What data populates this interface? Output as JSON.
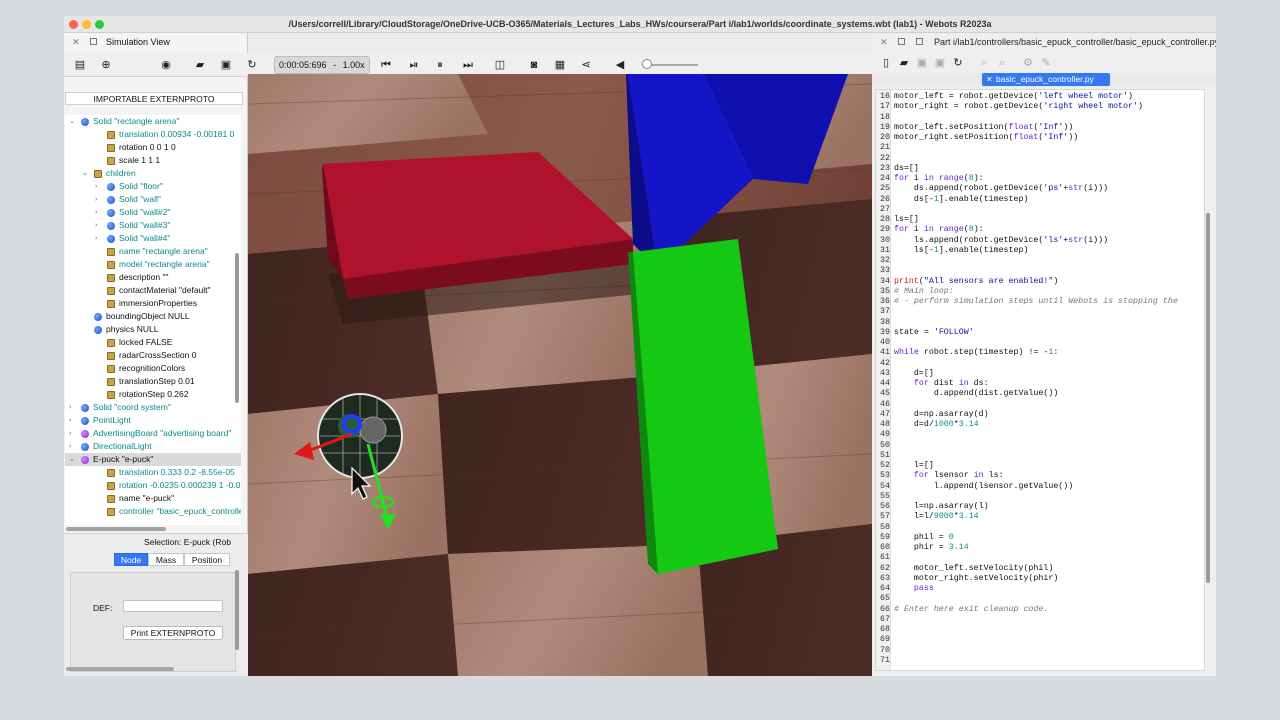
{
  "window": {
    "title": "/Users/correll/Library/CloudStorage/OneDrive-UCB-O365/Materials_Lectures_Labs_HWs/coursera/Part i/lab1/worlds/coordinate_systems.wbt (lab1) - Webots R2023a"
  },
  "simulation_view": {
    "title": "Simulation View",
    "time": "0:00:05:696",
    "speed": "1.00x"
  },
  "scene_tree": {
    "header": "IMPORTABLE EXTERNPROTO",
    "rows": [
      {
        "text": "Solid \"rectangle arena\"",
        "depth": 0,
        "icon": "ball",
        "arrow": "⌄",
        "color": "teal"
      },
      {
        "text": "translation 0.00934 -0.00181 0",
        "depth": 2,
        "icon": "box",
        "arrow": "",
        "color": "teal"
      },
      {
        "text": "rotation 0 0 1 0",
        "depth": 2,
        "icon": "box",
        "arrow": "",
        "color": "blk"
      },
      {
        "text": "scale 1 1 1",
        "depth": 2,
        "icon": "box",
        "arrow": "",
        "color": "blk"
      },
      {
        "text": "children",
        "depth": 1,
        "icon": "box",
        "arrow": "⌄",
        "color": "teal"
      },
      {
        "text": "Solid \"floor\"",
        "depth": 2,
        "icon": "ball",
        "arrow": "›",
        "color": "teal"
      },
      {
        "text": "Solid \"wall\"",
        "depth": 2,
        "icon": "ball",
        "arrow": "›",
        "color": "teal"
      },
      {
        "text": "Solid \"wall#2\"",
        "depth": 2,
        "icon": "ball",
        "arrow": "›",
        "color": "teal"
      },
      {
        "text": "Solid \"wall#3\"",
        "depth": 2,
        "icon": "ball",
        "arrow": "›",
        "color": "teal"
      },
      {
        "text": "Solid \"wall#4\"",
        "depth": 2,
        "icon": "ball",
        "arrow": "›",
        "color": "teal"
      },
      {
        "text": "name \"rectangle arena\"",
        "depth": 2,
        "icon": "box",
        "arrow": "",
        "color": "teal"
      },
      {
        "text": "model \"rectangle arena\"",
        "depth": 2,
        "icon": "box",
        "arrow": "",
        "color": "teal"
      },
      {
        "text": "description \"\"",
        "depth": 2,
        "icon": "box",
        "arrow": "",
        "color": "blk"
      },
      {
        "text": "contactMaterial \"default\"",
        "depth": 2,
        "icon": "box",
        "arrow": "",
        "color": "blk"
      },
      {
        "text": "immersionProperties",
        "depth": 2,
        "icon": "box",
        "arrow": "",
        "color": "blk"
      },
      {
        "text": "boundingObject NULL",
        "depth": 1,
        "icon": "ball",
        "arrow": "",
        "color": "blk"
      },
      {
        "text": "physics NULL",
        "depth": 1,
        "icon": "ball",
        "arrow": "",
        "color": "blk"
      },
      {
        "text": "locked FALSE",
        "depth": 2,
        "icon": "box",
        "arrow": "",
        "color": "blk"
      },
      {
        "text": "radarCrossSection 0",
        "depth": 2,
        "icon": "box",
        "arrow": "",
        "color": "blk"
      },
      {
        "text": "recognitionColors",
        "depth": 2,
        "icon": "box",
        "arrow": "",
        "color": "blk"
      },
      {
        "text": "translationStep 0.01",
        "depth": 2,
        "icon": "box",
        "arrow": "",
        "color": "blk"
      },
      {
        "text": "rotationStep 0.262",
        "depth": 2,
        "icon": "box",
        "arrow": "",
        "color": "blk"
      },
      {
        "text": "Solid \"coord system\"",
        "depth": 0,
        "icon": "ball",
        "arrow": "›",
        "color": "teal"
      },
      {
        "text": "PointLight",
        "depth": 0,
        "icon": "ball",
        "arrow": "›",
        "color": "teal"
      },
      {
        "text": "AdvertisingBoard \"advertising board\"",
        "depth": 0,
        "icon": "ballp",
        "arrow": "›",
        "color": "teal"
      },
      {
        "text": "DirectionalLight",
        "depth": 0,
        "icon": "ball",
        "arrow": "›",
        "color": "teal"
      },
      {
        "text": "E-puck \"e-puck\"",
        "depth": 0,
        "icon": "ballp",
        "arrow": "⌄",
        "color": "blk",
        "selected": true
      },
      {
        "text": "translation 0.333 0.2 -8.55e-05",
        "depth": 2,
        "icon": "box",
        "arrow": "",
        "color": "teal"
      },
      {
        "text": "rotation -0.0235 0.000239 1 -0.0",
        "depth": 2,
        "icon": "box",
        "arrow": "",
        "color": "teal"
      },
      {
        "text": "name \"e-puck\"",
        "depth": 2,
        "icon": "box",
        "arrow": "",
        "color": "blk"
      },
      {
        "text": "controller \"basic_epuck_controlle",
        "depth": 2,
        "icon": "box",
        "arrow": "",
        "color": "teal"
      }
    ]
  },
  "selection_panel": {
    "title": "Selection: E-puck (Rob",
    "tabs": [
      "Node",
      "Mass",
      "Position"
    ],
    "active_tab": "Node",
    "def_label": "DEF:",
    "def_value": "",
    "print_button": "Print EXTERNPROTO"
  },
  "editor": {
    "path": "Part i/lab1/controllers/basic_epuck_controller/basic_epuck_controller.py",
    "tab": "basic_epuck_controller.py",
    "lines": [
      {
        "n": 16,
        "html": "motor_left = robot.getDevice(<span class=\"str\">'left wheel motor'</span>)"
      },
      {
        "n": 17,
        "html": "motor_right = robot.getDevice(<span class=\"str\">'right wheel motor'</span>)"
      },
      {
        "n": 18,
        "html": ""
      },
      {
        "n": 19,
        "html": "motor_left.setPosition(<span class=\"kw\">float</span>(<span class=\"str\">'Inf'</span>))"
      },
      {
        "n": 20,
        "html": "motor_right.setPosition(<span class=\"kw\">float</span>(<span class=\"str\">'Inf'</span>))"
      },
      {
        "n": 21,
        "html": ""
      },
      {
        "n": 22,
        "html": ""
      },
      {
        "n": 23,
        "html": "ds=[]"
      },
      {
        "n": 24,
        "html": "<span class=\"kw\">for</span> i <span class=\"kw\">in</span> <span class=\"kw\">range</span>(<span class=\"num\">8</span>):"
      },
      {
        "n": 25,
        "html": "    ds.append(robot.getDevice(<span class=\"str\">'ps'</span>+<span class=\"kw\">str</span>(i)))"
      },
      {
        "n": 26,
        "html": "    ds[-<span class=\"num\">1</span>].enable(timestep)"
      },
      {
        "n": 27,
        "html": ""
      },
      {
        "n": 28,
        "html": "ls=[]"
      },
      {
        "n": 29,
        "html": "<span class=\"kw\">for</span> i <span class=\"kw\">in</span> <span class=\"kw\">range</span>(<span class=\"num\">8</span>):"
      },
      {
        "n": 30,
        "html": "    ls.append(robot.getDevice(<span class=\"str\">'ls'</span>+<span class=\"kw\">str</span>(i)))"
      },
      {
        "n": 31,
        "html": "    ls[-<span class=\"num\">1</span>].enable(timestep)"
      },
      {
        "n": 32,
        "html": ""
      },
      {
        "n": 33,
        "html": ""
      },
      {
        "n": 34,
        "html": "<span class=\"fn\">print</span>(<span class=\"str\">\"All sensors are enabled!\"</span>)"
      },
      {
        "n": 35,
        "html": "<span class=\"cm\"># Main loop:</span>"
      },
      {
        "n": 36,
        "html": "<span class=\"cm\"># - perform simulation steps until Webots is stopping the</span>"
      },
      {
        "n": 37,
        "html": ""
      },
      {
        "n": 38,
        "html": ""
      },
      {
        "n": 39,
        "html": "state = <span class=\"str\">'FOLLOW'</span>"
      },
      {
        "n": 40,
        "html": ""
      },
      {
        "n": 41,
        "html": "<span class=\"kw\">while</span> robot.step(timestep) != -<span class=\"num\">1</span>:"
      },
      {
        "n": 42,
        "html": ""
      },
      {
        "n": 43,
        "html": "    d=[]"
      },
      {
        "n": 44,
        "html": "    <span class=\"kw\">for</span> dist <span class=\"kw\">in</span> ds:"
      },
      {
        "n": 45,
        "html": "        d.append(dist.getValue())"
      },
      {
        "n": 46,
        "html": ""
      },
      {
        "n": 47,
        "html": "    d=np.asarray(d)"
      },
      {
        "n": 48,
        "html": "    d=d/<span class=\"num\">1000</span>*<span class=\"num\">3.14</span>"
      },
      {
        "n": 49,
        "html": ""
      },
      {
        "n": 50,
        "html": ""
      },
      {
        "n": 51,
        "html": ""
      },
      {
        "n": 52,
        "html": "    l=[]"
      },
      {
        "n": 53,
        "html": "    <span class=\"kw\">for</span> lsensor <span class=\"kw\">in</span> ls:"
      },
      {
        "n": 54,
        "html": "        l.append(lsensor.getValue())"
      },
      {
        "n": 55,
        "html": ""
      },
      {
        "n": 56,
        "html": "    l=np.asarray(l)"
      },
      {
        "n": 57,
        "html": "    l=l/<span class=\"num\">9000</span>*<span class=\"num\">3.14</span>"
      },
      {
        "n": 58,
        "html": ""
      },
      {
        "n": 59,
        "html": "    phil = <span class=\"num\">0</span>"
      },
      {
        "n": 60,
        "html": "    phir = <span class=\"num\">3.14</span>"
      },
      {
        "n": 61,
        "html": ""
      },
      {
        "n": 62,
        "html": "    motor_left.setVelocity(phil)"
      },
      {
        "n": 63,
        "html": "    motor_right.setVelocity(phir)"
      },
      {
        "n": 64,
        "html": "    <span class=\"kw\">pass</span>"
      },
      {
        "n": 65,
        "html": ""
      },
      {
        "n": 66,
        "html": "<span class=\"cm\"># Enter here exit cleanup code.</span>"
      },
      {
        "n": 67,
        "html": ""
      },
      {
        "n": 68,
        "html": ""
      },
      {
        "n": 69,
        "html": ""
      },
      {
        "n": 70,
        "html": ""
      },
      {
        "n": 71,
        "html": ""
      }
    ]
  },
  "colors": {
    "red_block": "#b0112b",
    "blue_block": "#1414c8",
    "green_block": "#14c814",
    "accent": "#3478f6"
  }
}
